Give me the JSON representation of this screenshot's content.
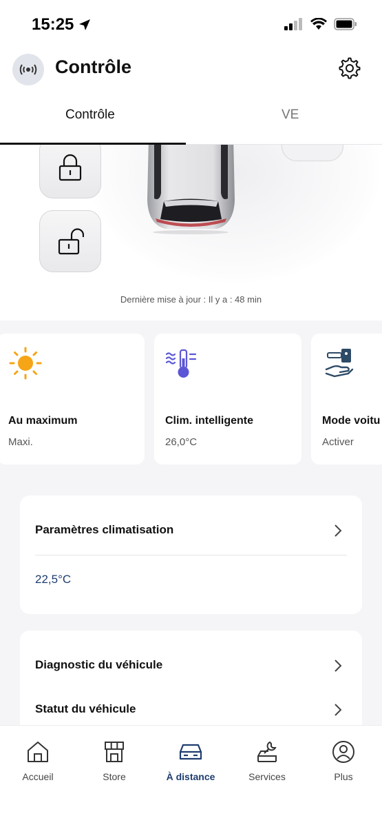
{
  "status_bar": {
    "time": "15:25"
  },
  "header": {
    "title": "Contrôle"
  },
  "tabs": [
    {
      "label": "Contrôle",
      "active": true
    },
    {
      "label": "VE",
      "active": false
    }
  ],
  "vehicle": {
    "last_update": "Dernière mise à jour : Il y a : 48 min"
  },
  "cards": [
    {
      "title": "Au maximum",
      "subtitle": "Maxi.",
      "icon": "sun-icon"
    },
    {
      "title": "Clim. intelligente",
      "subtitle": "26,0°C",
      "icon": "thermometer-icon"
    },
    {
      "title": "Mode voitu",
      "subtitle": "Activer",
      "icon": "valet-hand-icon"
    }
  ],
  "climate_settings": {
    "title": "Paramètres climatisation",
    "value": "22,5°C"
  },
  "vehicle_menu": [
    {
      "label": "Diagnostic du véhicule"
    },
    {
      "label": "Statut du véhicule"
    }
  ],
  "bottom_nav": [
    {
      "label": "Accueil",
      "icon": "home-icon"
    },
    {
      "label": "Store",
      "icon": "store-icon"
    },
    {
      "label": "À distance",
      "icon": "car-icon",
      "active": true
    },
    {
      "label": "Services",
      "icon": "services-icon"
    },
    {
      "label": "Plus",
      "icon": "profile-icon"
    }
  ],
  "colors": {
    "accent": "#1d3c6e",
    "sun": "#f5a516",
    "thermo": "#5b57d6"
  }
}
